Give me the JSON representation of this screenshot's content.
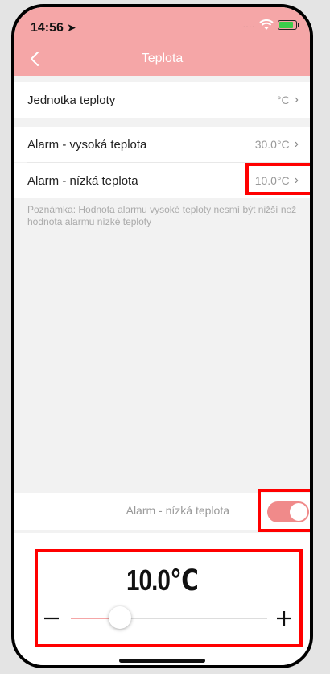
{
  "status_bar": {
    "time": "14:56",
    "signal": "....."
  },
  "nav": {
    "title": "Teplota"
  },
  "settings": {
    "unit_label": "Jednotka teploty",
    "unit_value": "°C",
    "high_alarm_label": "Alarm - vysoká teplota",
    "high_alarm_value": "30.0°C",
    "low_alarm_label": "Alarm - nízká teplota",
    "low_alarm_value": "10.0°C"
  },
  "note": "Poznámka: Hodnota alarmu vysoké teploty nesmí být nižší než hodnota alarmu nízké teploty",
  "alarm_toggle": {
    "label": "Alarm - nízká teplota",
    "enabled": true
  },
  "picker": {
    "value_display": "10.0℃",
    "slider_fraction": 0.25
  },
  "colors": {
    "accent": "#f5a6a7",
    "toggle_on": "#f08a8a",
    "highlight": "#ff0000"
  },
  "icons": {
    "back": "chevron-left-icon",
    "location": "location-arrow-icon",
    "wifi": "wifi-icon",
    "battery": "battery-charging-icon",
    "row_chevron": "chevron-right-icon",
    "minus": "minus-icon",
    "plus": "plus-icon"
  }
}
